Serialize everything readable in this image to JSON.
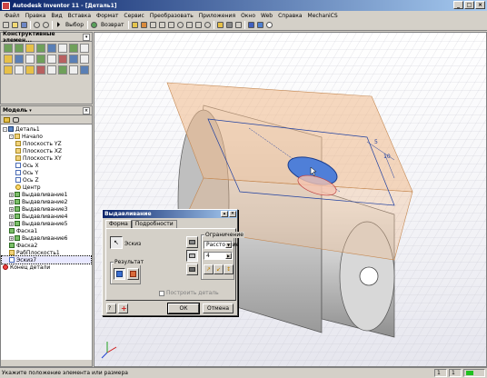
{
  "window": {
    "title": "Autodesk Inventor 11 - [Деталь1]"
  },
  "menu": [
    "Файл",
    "Правка",
    "Вид",
    "Вставка",
    "Формат",
    "Сервис",
    "Преобразовать",
    "Приложения",
    "Окно",
    "Web",
    "Справка",
    "MechaniCS"
  ],
  "toolbar": {
    "select_label": "Выбор",
    "return_label": "Возврат"
  },
  "features_panel": {
    "title": "Конструктивные элемен..."
  },
  "model_panel": {
    "title": "Модель"
  },
  "tree": [
    {
      "label": "Деталь1",
      "kind": "part",
      "level": 0,
      "exp": "-"
    },
    {
      "label": "Начало",
      "kind": "folder",
      "level": 1,
      "exp": "-"
    },
    {
      "label": "Плоскость YZ",
      "kind": "plane",
      "level": 2
    },
    {
      "label": "Плоскость XZ",
      "kind": "plane",
      "level": 2
    },
    {
      "label": "Плоскость XY",
      "kind": "plane",
      "level": 2
    },
    {
      "label": "Ось X",
      "kind": "axis",
      "level": 2
    },
    {
      "label": "Ось Y",
      "kind": "axis",
      "level": 2
    },
    {
      "label": "Ось Z",
      "kind": "axis",
      "level": 2
    },
    {
      "label": "Центр",
      "kind": "pt",
      "level": 2
    },
    {
      "label": "Выдавливание1",
      "kind": "feat",
      "level": 1,
      "exp": "+"
    },
    {
      "label": "Выдавливание2",
      "kind": "feat",
      "level": 1,
      "exp": "+"
    },
    {
      "label": "Выдавливание3",
      "kind": "feat",
      "level": 1,
      "exp": "+"
    },
    {
      "label": "Выдавливание4",
      "kind": "feat",
      "level": 1,
      "exp": "+"
    },
    {
      "label": "Выдавливание5",
      "kind": "feat",
      "level": 1,
      "exp": "+"
    },
    {
      "label": "Фаска1",
      "kind": "feat",
      "level": 1
    },
    {
      "label": "Выдавливание6",
      "kind": "feat",
      "level": 1,
      "exp": "+"
    },
    {
      "label": "Фаска2",
      "kind": "feat",
      "level": 1
    },
    {
      "label": "РабПлоскость1",
      "kind": "plane",
      "level": 1
    },
    {
      "label": "Эскиз7",
      "kind": "sketch",
      "level": 1,
      "sel": true
    },
    {
      "label": "Конец детали",
      "kind": "end",
      "level": 0
    }
  ],
  "dialog": {
    "title": "Выдавливание",
    "tabs": [
      "Форма",
      "Подробности"
    ],
    "sketch_label": "Эскиз",
    "result_group": "Результат",
    "limit_group": "Ограничение",
    "limit_value": "Расстояние",
    "distance_value": "4",
    "checkbox_label": "Построить деталь",
    "ok_label": "ОК",
    "cancel_label": "Отмена"
  },
  "viewport": {
    "dims": [
      "5",
      "10"
    ]
  },
  "status": {
    "text": "Укажите положение элемента или размера",
    "cell1": "1",
    "cell2": "1"
  },
  "colors": {
    "title_start": "#0a246a",
    "title_end": "#a6caf0",
    "part_shade": "#c9c9c9",
    "plane": "#f0b98a",
    "sketch_fill": "#4f7fd8"
  }
}
